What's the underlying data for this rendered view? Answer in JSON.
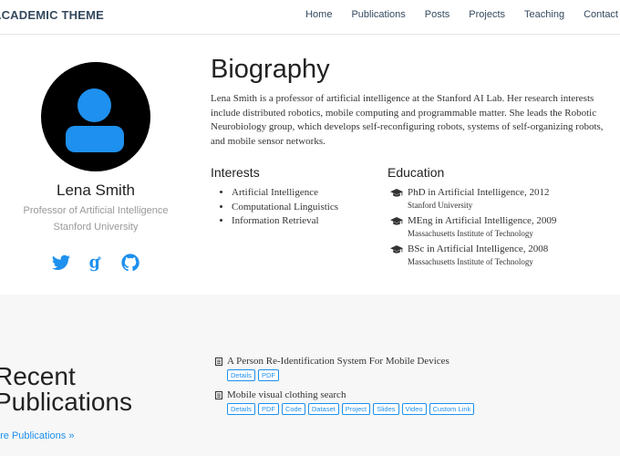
{
  "brand": "ACADEMIC THEME",
  "nav": [
    "Home",
    "Publications",
    "Posts",
    "Projects",
    "Teaching",
    "Contact"
  ],
  "profile": {
    "name": "Lena Smith",
    "role": "Professor of Artificial Intelligence",
    "affiliation": "Stanford University",
    "avatar_color": "#1e90ef",
    "socials": [
      "twitter-icon",
      "google-scholar-icon",
      "github-icon"
    ]
  },
  "biography": {
    "title": "Biography",
    "text": "Lena Smith is a professor of artificial intelligence at the Stanford AI Lab. Her research interests include distributed robotics, mobile computing and programmable matter. She leads the Robotic Neurobiology group, which develops self-reconfiguring robots, systems of self-organizing robots, and mobile sensor networks."
  },
  "interests": {
    "title": "Interests",
    "items": [
      "Artificial Intelligence",
      "Computational Linguistics",
      "Information Retrieval"
    ]
  },
  "education": {
    "title": "Education",
    "items": [
      {
        "degree": "PhD in Artificial Intelligence, 2012",
        "institution": "Stanford University"
      },
      {
        "degree": "MEng in Artificial Intelligence, 2009",
        "institution": "Massachusetts Institute of Technology"
      },
      {
        "degree": "BSc in Artificial Intelligence, 2008",
        "institution": "Massachusetts Institute of Technology"
      }
    ]
  },
  "publications": {
    "heading_line1": "Recent",
    "heading_line2": "Publications",
    "more_link": "ore Publications »",
    "items": [
      {
        "title": "A Person Re-Identification System For Mobile Devices",
        "buttons": [
          "Details",
          "PDF"
        ]
      },
      {
        "title": "Mobile visual clothing search",
        "buttons": [
          "Details",
          "PDF",
          "Code",
          "Dataset",
          "Project",
          "Slides",
          "Video",
          "Custom Link"
        ]
      }
    ]
  },
  "colors": {
    "accent": "#1e90ef",
    "section_bg": "#f7f7f7"
  }
}
